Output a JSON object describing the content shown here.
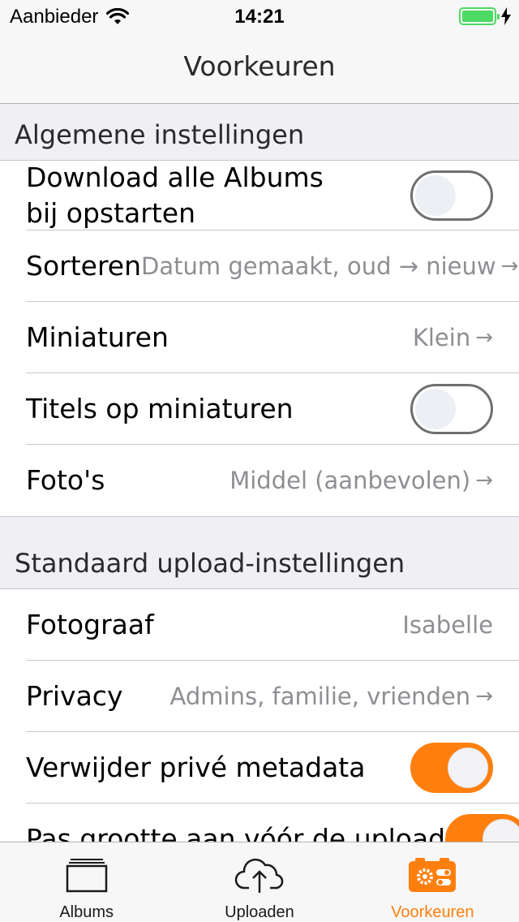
{
  "status_bar": {
    "carrier": "Aanbieder",
    "time": "14:21",
    "wifi_icon": "wifi-icon",
    "battery_icon": "battery-full-icon"
  },
  "nav": {
    "title": "Voorkeuren"
  },
  "sections": {
    "general": {
      "header": "Algemene instellingen",
      "download_albums": {
        "label_line1": "Download alle Albums",
        "label_line2": "bij opstarten",
        "toggle_on": false
      },
      "sort": {
        "label": "Sorteren",
        "value": "Datum gemaakt, oud → nieuw",
        "arrow": "→"
      },
      "thumbnails": {
        "label": "Miniaturen",
        "value": "Klein",
        "arrow": "→"
      },
      "titles_on_thumbnails": {
        "label": "Titels op miniaturen",
        "toggle_on": false
      },
      "photos": {
        "label": "Foto's",
        "value": "Middel (aanbevolen)",
        "arrow": "→"
      }
    },
    "upload": {
      "header": "Standaard upload-instellingen",
      "photographer": {
        "label": "Fotograaf",
        "value": "Isabelle"
      },
      "privacy": {
        "label": "Privacy",
        "value": "Admins, familie, vrienden",
        "arrow": "→"
      },
      "strip_metadata": {
        "label": "Verwijder privé metadata",
        "toggle_on": true
      },
      "resize": {
        "label": "Pas grootte aan vóór de upload",
        "toggle_on": true
      }
    }
  },
  "tabs": [
    {
      "label": "Albums",
      "icon": "albums-icon",
      "active": false
    },
    {
      "label": "Uploaden",
      "icon": "cloud-upload-icon",
      "active": false
    },
    {
      "label": "Voorkeuren",
      "icon": "settings-icon",
      "active": true
    }
  ],
  "colors": {
    "accent": "#ff7f0e",
    "battery": "#4cd964",
    "secondary_text": "#8e8e93"
  }
}
